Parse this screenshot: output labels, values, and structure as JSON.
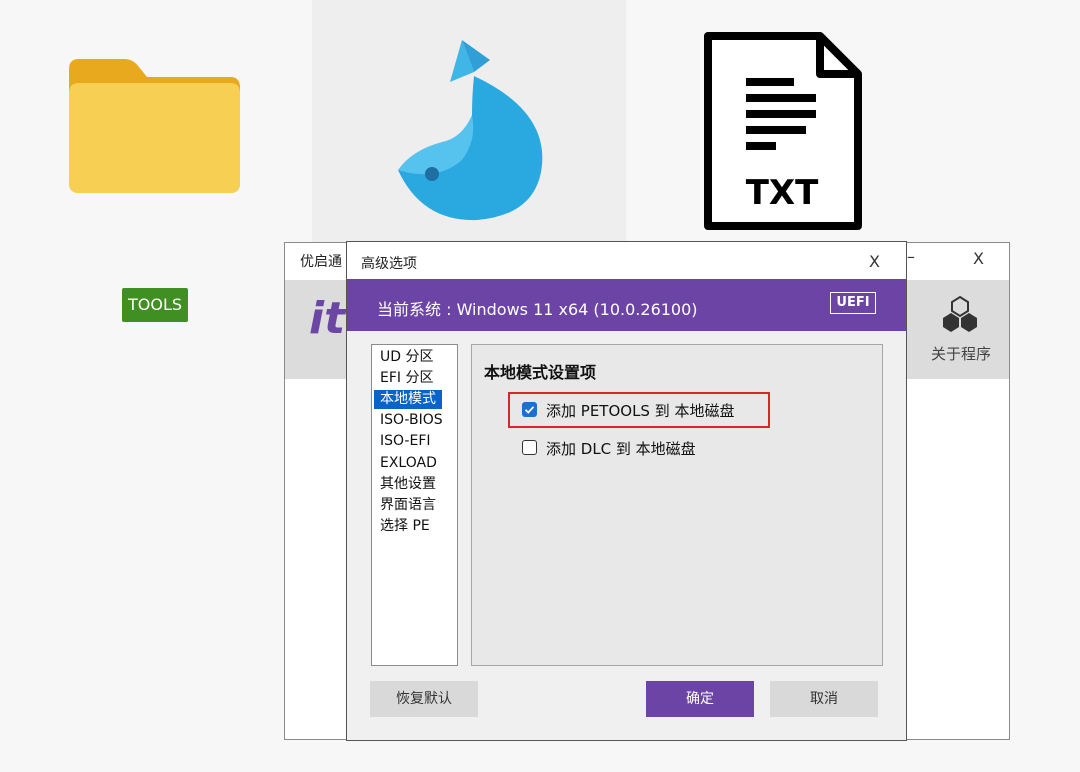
{
  "desktop": {
    "tools_label": "TOOLS",
    "txt_icon_text": "TXT"
  },
  "main_window": {
    "title": "优启通",
    "logo_text": "it",
    "minimize_glyph": "–",
    "close_glyph": "X",
    "about_label": "关于程序"
  },
  "dialog": {
    "title": "高级选项",
    "close_glyph": "X",
    "system_info": "当前系统 : Windows 11 x64 (10.0.26100)",
    "uefi_badge": "UEFI",
    "nav_items": [
      "UD 分区",
      "EFI 分区",
      "本地模式",
      "ISO-BIOS",
      "ISO-EFI",
      "EXLOAD",
      "其他设置",
      "界面语言",
      "选择 PE"
    ],
    "selected_nav": "本地模式",
    "panel_title": "本地模式设置项",
    "options": [
      {
        "label": "添加 PETOOLS 到 本地磁盘",
        "checked": true
      },
      {
        "label": "添加 DLC 到 本地磁盘",
        "checked": false
      }
    ],
    "buttons": {
      "restore": "恢复默认",
      "ok": "确定",
      "cancel": "取消"
    }
  },
  "colors": {
    "accent_purple": "#6c44a6",
    "selection_blue": "#0a63c9",
    "highlight_red": "#d7262c",
    "folder_yellow": "#f5c53b",
    "fish_blue": "#2aa8e0"
  }
}
